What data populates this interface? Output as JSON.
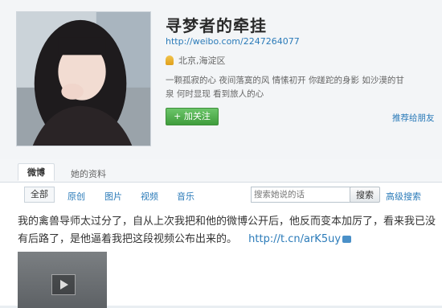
{
  "profile": {
    "name": "寻梦者的牵挂",
    "url": "http://weibo.com/2247264077",
    "location": "北京,海淀区",
    "bio_line1": "一颗孤寂的心  夜间落寞的风  情愫初开  你蹉跎的身影  如沙漠的甘",
    "bio_line2": "泉  何时显现  看到旅人的心",
    "follow_label": "+ 加关注",
    "recommend_label": "推荐给朋友"
  },
  "tabs": {
    "weibo": "微博",
    "profile": "她的资料"
  },
  "filter": {
    "items": [
      "全部",
      "原创",
      "图片",
      "视频",
      "音乐"
    ],
    "search_placeholder": "搜索她说的话",
    "search_button": "搜索",
    "advanced_search": "高级搜索"
  },
  "post": {
    "text": "我的禽兽导师太过分了，自从上次我把和他的微博公开后，他反而变本加厉了，看来我已没有后路了，是他逼着我把这段视频公布出来的。",
    "link": "http://t.cn/arK5uy"
  },
  "icons": {
    "location": "location-pin-icon",
    "video": "video-icon",
    "play": "play-icon"
  }
}
